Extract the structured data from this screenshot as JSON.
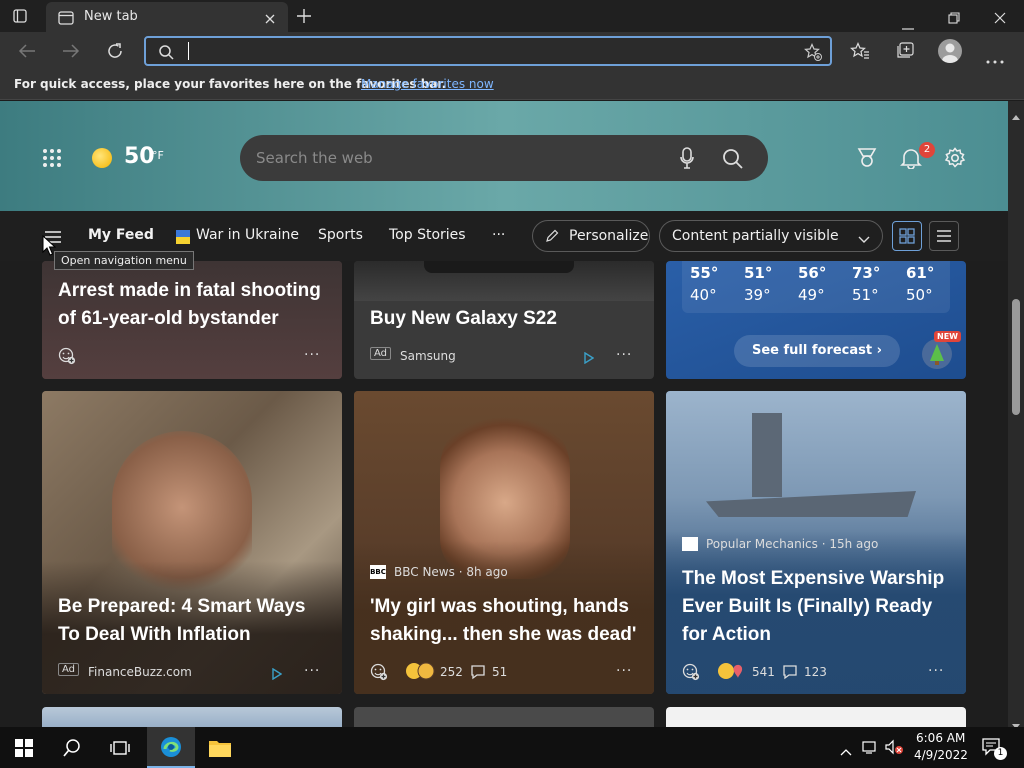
{
  "window": {
    "tab_title": "New tab"
  },
  "toolbar": {
    "address_value": ""
  },
  "favbar": {
    "message": "For quick access, place your favorites here on the favorites bar.",
    "link": "Manage favorites now"
  },
  "hero": {
    "temperature": "50",
    "unit": "°F",
    "search_placeholder": "Search the web",
    "notification_count": "2"
  },
  "nav": {
    "tooltip": "Open navigation menu",
    "items": [
      "My Feed",
      "War in Ukraine",
      "Sports",
      "Top Stories"
    ],
    "more": "···",
    "personalize": "Personalize",
    "visibility": "Content partially visible"
  },
  "cards_top": {
    "c1": {
      "title": "Arrest made in fatal shooting of 61-year-old bystander"
    },
    "c2": {
      "title": "Buy New Galaxy S22",
      "ad": "Ad",
      "source": "Samsung"
    },
    "weather": {
      "highs": [
        "55°",
        "51°",
        "56°",
        "73°",
        "61°"
      ],
      "lows": [
        "40°",
        "39°",
        "49°",
        "51°",
        "50°"
      ],
      "button": "See full forecast",
      "badge": "NEW"
    }
  },
  "cards_mid": {
    "c1": {
      "title": "Be Prepared: 4 Smart Ways To Deal With Inflation",
      "ad": "Ad",
      "source": "FinanceBuzz.com"
    },
    "c2": {
      "source": "BBC News · 8h ago",
      "title": "'My girl was shouting, hands shaking... then she was dead'",
      "reactions": "252",
      "comments": "51"
    },
    "c3": {
      "source": "Popular Mechanics · 15h ago",
      "title": "The Most Expensive Warship Ever Built Is (Finally) Ready for Action",
      "reactions": "541",
      "comments": "123"
    }
  },
  "taskbar": {
    "time": "6:06 AM",
    "date": "4/9/2022",
    "notif_count": "1"
  },
  "colors": {
    "accent": "#6ea0d8",
    "badge_red": "#e0453a",
    "link": "#7eb6ff"
  }
}
